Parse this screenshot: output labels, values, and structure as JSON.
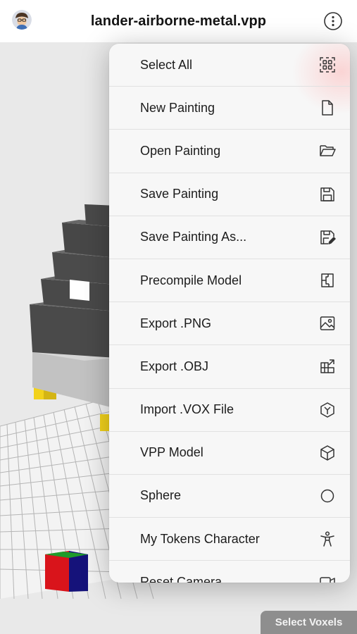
{
  "header": {
    "title": "lander-airborne-metal.vpp"
  },
  "menu": {
    "items": [
      {
        "label": "Select All",
        "icon": "select-all-icon"
      },
      {
        "label": "New Painting",
        "icon": "new-file-icon"
      },
      {
        "label": "Open Painting",
        "icon": "folder-icon"
      },
      {
        "label": "Save Painting",
        "icon": "save-icon"
      },
      {
        "label": "Save Painting As...",
        "icon": "save-as-icon"
      },
      {
        "label": "Precompile Model",
        "icon": "precompile-icon"
      },
      {
        "label": "Export .PNG",
        "icon": "image-icon"
      },
      {
        "label": "Export .OBJ",
        "icon": "export-obj-icon"
      },
      {
        "label": "Import .VOX File",
        "icon": "import-vox-icon"
      },
      {
        "label": "VPP Model",
        "icon": "cube-icon"
      },
      {
        "label": "Sphere",
        "icon": "circle-icon"
      },
      {
        "label": "My Tokens Character",
        "icon": "character-icon"
      },
      {
        "label": "Reset Camera",
        "icon": "camera-icon"
      }
    ]
  },
  "footer": {
    "select_voxels_label": "Select Voxels"
  },
  "colors": {
    "menu_bg": "#f7f7f7",
    "viewport_bg": "#e9e9e9",
    "voxel_dark": "#4a4a4a",
    "voxel_light": "#b8b8b8",
    "voxel_yellow": "#f2d21b",
    "axis_red": "#d9141b",
    "axis_blue": "#15127a",
    "axis_green": "#1e9b2a"
  }
}
